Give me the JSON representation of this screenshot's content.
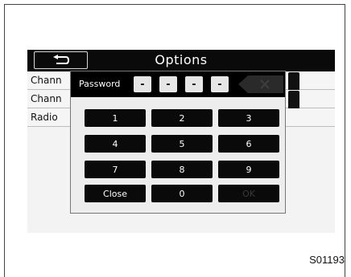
{
  "screen": {
    "title": "Options",
    "back_icon": "back-arrow-icon",
    "list": [
      {
        "label": "Chann"
      },
      {
        "label": "Chann"
      },
      {
        "label": "Radio"
      }
    ]
  },
  "dialog": {
    "password_label": "Password",
    "digits": [
      "-",
      "-",
      "-",
      "-"
    ],
    "delete_icon": "close-x-icon",
    "keys": [
      {
        "label": "1"
      },
      {
        "label": "2"
      },
      {
        "label": "3"
      },
      {
        "label": "4"
      },
      {
        "label": "5"
      },
      {
        "label": "6"
      },
      {
        "label": "7"
      },
      {
        "label": "8"
      },
      {
        "label": "9"
      },
      {
        "label": "Close"
      },
      {
        "label": "0"
      },
      {
        "label": "OK"
      }
    ]
  },
  "figure_code": "S01193"
}
